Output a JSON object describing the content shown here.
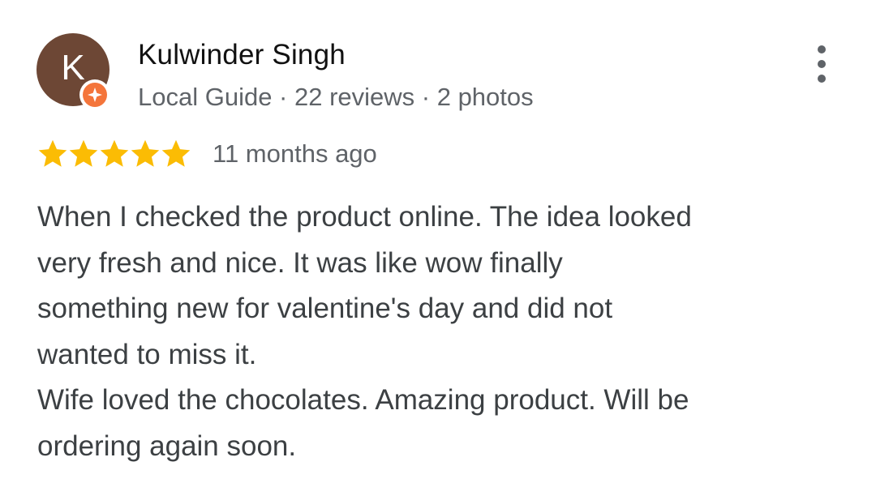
{
  "reviewer": {
    "initial": "K",
    "name": "Kulwinder Singh",
    "meta": "Local Guide · 22 reviews · 2 photos",
    "avatar_color": "#6d4735",
    "badge_color": "#f4753b"
  },
  "review": {
    "rating": 5,
    "rating_max": 5,
    "star_color": "#fbbc04",
    "date": "11 months ago",
    "lines": [
      "When I checked the product online. The idea looked",
      "very fresh and nice. It was like wow finally",
      "something new for valentine's day and did not",
      "wanted to miss it.",
      "Wife loved the chocolates. Amazing product. Will be",
      "ordering again soon."
    ]
  },
  "icons": {
    "more": "more-vert-icon",
    "badge": "local-guide-star-icon",
    "star": "star-icon"
  }
}
